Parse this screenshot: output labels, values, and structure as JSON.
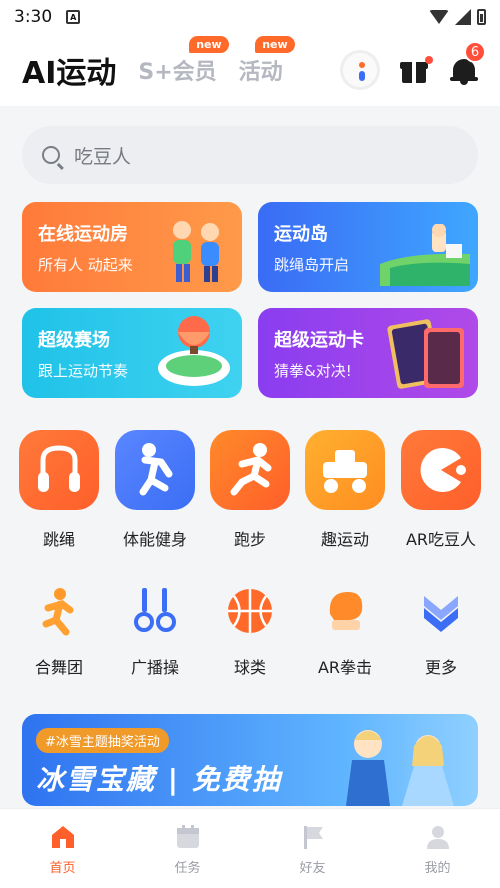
{
  "status_bar": {
    "time": "3:30"
  },
  "header": {
    "logo": "AI运动",
    "tabs": [
      {
        "label": "S+会员",
        "badge": "new"
      },
      {
        "label": "活动",
        "badge": "new"
      }
    ],
    "notification_count": "6"
  },
  "search": {
    "placeholder": "吃豆人"
  },
  "feature_cards": [
    {
      "title": "在线运动房",
      "subtitle": "所有人 动起来"
    },
    {
      "title": "运动岛",
      "subtitle": "跳绳岛开启"
    },
    {
      "title": "超级赛场",
      "subtitle": "跟上运动节奏"
    },
    {
      "title": "超级运动卡",
      "subtitle": "猜拳&对决!"
    }
  ],
  "sports_primary": [
    {
      "label": "跳绳",
      "icon": "jump-rope-icon"
    },
    {
      "label": "体能健身",
      "icon": "fitness-icon"
    },
    {
      "label": "跑步",
      "icon": "running-icon"
    },
    {
      "label": "趣运动",
      "icon": "fun-sport-icon"
    },
    {
      "label": "AR吃豆人",
      "icon": "pacman-icon"
    }
  ],
  "sports_secondary": [
    {
      "label": "合舞团",
      "icon": "dance-icon"
    },
    {
      "label": "广播操",
      "icon": "broadcast-exercise-icon"
    },
    {
      "label": "球类",
      "icon": "basketball-icon"
    },
    {
      "label": "AR拳击",
      "icon": "boxing-glove-icon"
    },
    {
      "label": "更多",
      "icon": "more-chevron-icon"
    }
  ],
  "banner": {
    "tag": "#冰雪主题抽奖活动",
    "title": "冰雪宝藏 | 免费抽"
  },
  "tabbar": [
    {
      "label": "首页",
      "active": true
    },
    {
      "label": "任务"
    },
    {
      "label": "好友"
    },
    {
      "label": "我的"
    }
  ],
  "colors": {
    "accent": "#ff5f2a",
    "blue": "#3b6ef5"
  }
}
